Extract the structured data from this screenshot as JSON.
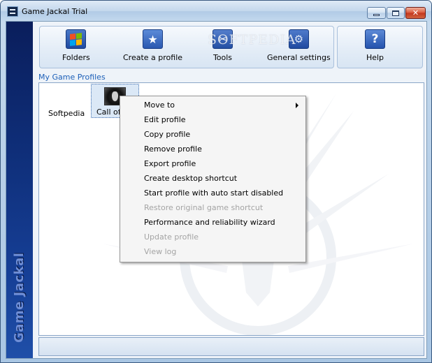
{
  "window": {
    "title": "Game Jackal Trial",
    "side_label": "Game Jackal"
  },
  "toolbar": {
    "folders_label": "Folders",
    "create_profile_label": "Create a profile",
    "tools_label": "Tools",
    "general_settings_label": "General settings",
    "help_label": "Help",
    "help_glyph": "?"
  },
  "watermark": "SOFTPEDIA",
  "profiles": {
    "section_title": "My Game Profiles",
    "folder_name": "Softpedia",
    "selected_profile_label": "Call of D"
  },
  "context_menu": {
    "items": [
      {
        "label": "Move to",
        "enabled": true,
        "submenu": true
      },
      {
        "label": "Edit profile",
        "enabled": true
      },
      {
        "label": "Copy profile",
        "enabled": true
      },
      {
        "label": "Remove profile",
        "enabled": true
      },
      {
        "label": "Export profile",
        "enabled": true
      },
      {
        "label": "Create desktop shortcut",
        "enabled": true
      },
      {
        "label": "Start profile with auto start disabled",
        "enabled": true
      },
      {
        "label": "Restore original game shortcut",
        "enabled": false
      },
      {
        "label": "Performance and reliability wizard",
        "enabled": true
      },
      {
        "label": "Update profile",
        "enabled": false
      },
      {
        "label": "View log",
        "enabled": false
      }
    ]
  },
  "icons": {
    "folders": "windows-folder-icon",
    "create_profile": "star-icon",
    "tools": "tools-icon",
    "general_settings": "gears-icon",
    "help": "help-icon"
  },
  "colors": {
    "accent": "#1c5fb8",
    "side_strip": "#0f2f7a",
    "disabled_text": "#a4a4a4"
  }
}
